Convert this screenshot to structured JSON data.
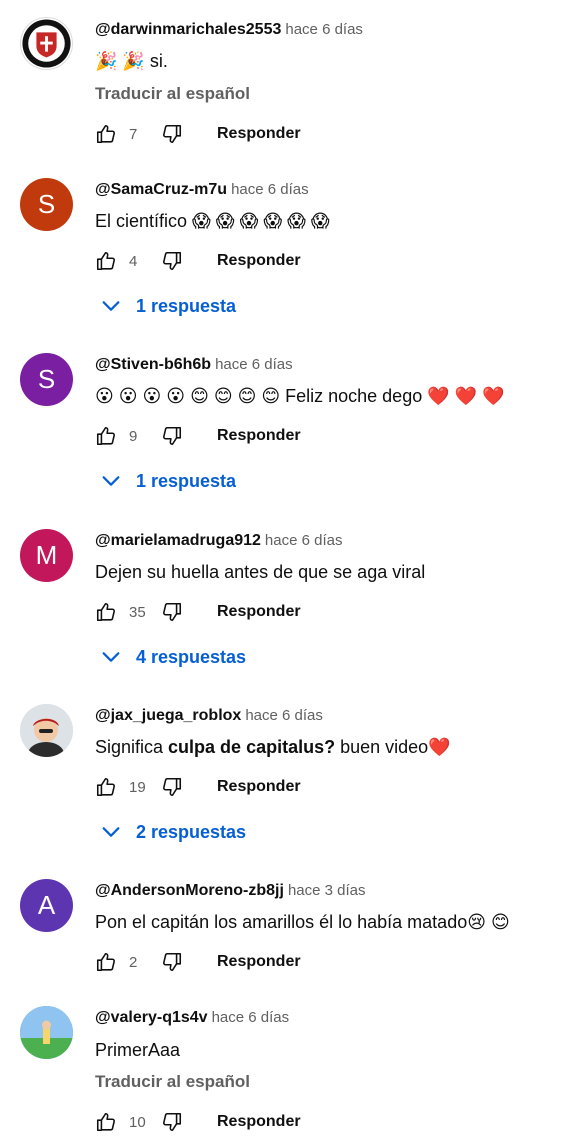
{
  "comments": [
    {
      "handle": "@darwinmarichales2553",
      "time": "hace 6 días",
      "text": "🎉 🎉 si.",
      "translate": "Traducir al español",
      "likes": "7",
      "reply": "Responder"
    },
    {
      "handle": "@SamaCruz-m7u",
      "time": "hace 6 días",
      "initial": "S",
      "avatar_color": "#c03a0d",
      "text": "El científico 😱 😱 😱 😱 😱 😱",
      "likes": "4",
      "reply": "Responder",
      "replies": "1 respuesta"
    },
    {
      "handle": "@Stiven-b6h6b",
      "time": "hace 6 días",
      "initial": "S",
      "avatar_color": "#7b1fa2",
      "text": "😮 😮 😮 😮 😊 😊 😊 😊 Feliz noche dego ❤️ ❤️ ❤️",
      "likes": "9",
      "reply": "Responder",
      "replies": "1 respuesta"
    },
    {
      "handle": "@marielamadruga912",
      "time": "hace 6 días",
      "initial": "M",
      "avatar_color": "#c2185b",
      "text": "Dejen su huella antes de que se aga viral",
      "likes": "35",
      "reply": "Responder",
      "replies": "4 respuestas"
    },
    {
      "handle": "@jax_juega_roblox",
      "time": "hace 6 días",
      "text_pre": "Significa ",
      "text_bold": "culpa de capitalus?",
      "text_post": " buen video❤️",
      "likes": "19",
      "reply": "Responder",
      "replies": "2 respuestas"
    },
    {
      "handle": "@AndersonMoreno-zb8jj",
      "time": "hace 3 días",
      "initial": "A",
      "avatar_color": "#5e35b1",
      "text": "Pon el capitán los amarillos él lo había matado😢 😊",
      "likes": "2",
      "reply": "Responder"
    },
    {
      "handle": "@valery-q1s4v",
      "time": "hace 6 días",
      "text": "PrimerAaa",
      "translate": "Traducir al español",
      "likes": "10",
      "reply": "Responder"
    }
  ],
  "colors": {
    "link": "#065fd4",
    "secondary": "#606060"
  },
  "icons": {
    "like": "thumb-up-icon",
    "dislike": "thumb-down-icon",
    "expand": "chevron-down-icon"
  }
}
